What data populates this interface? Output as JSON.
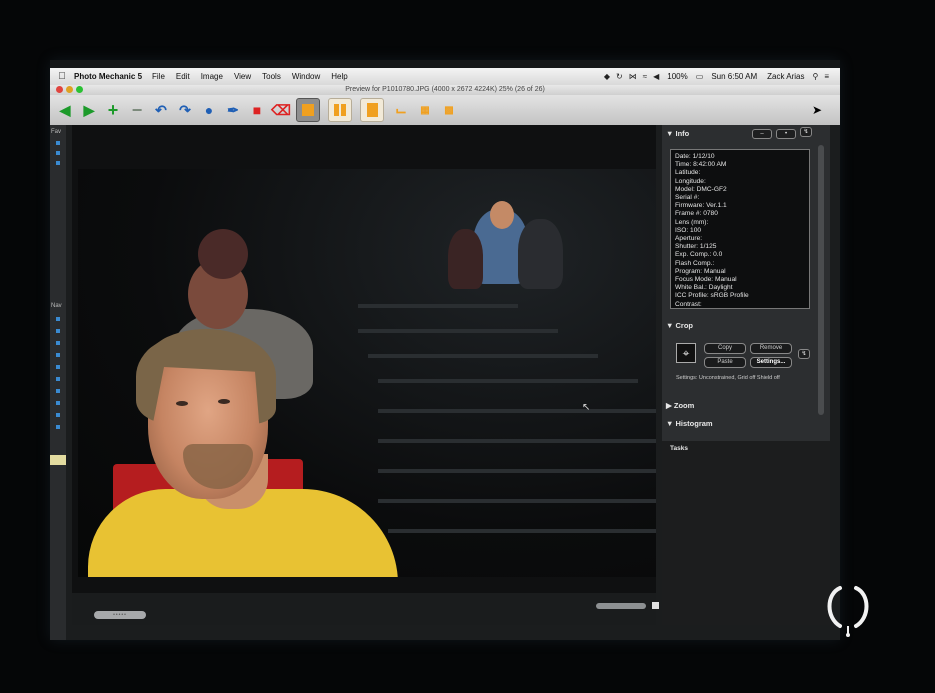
{
  "menubar": {
    "app_name": "Photo Mechanic 5",
    "items": [
      "File",
      "Edit",
      "Image",
      "View",
      "Tools",
      "Window",
      "Help"
    ],
    "battery": "100%",
    "clock": "Sun 6:50 AM",
    "user": "Zack Arias"
  },
  "window": {
    "title": "Preview for P1010780.JPG (4000 x 2672 4224K) 25% (26 of 26)"
  },
  "sidebar": {
    "label_top": "Fav",
    "label_nav": "Nav"
  },
  "info_panel": {
    "header": "Info",
    "lines": [
      "Date: 1/12/10",
      "Time: 8:42:00 AM",
      "Latitude:",
      "Longitude:",
      "Model: DMC-GF2",
      "Serial #:",
      "Firmware: Ver.1.1",
      "Frame #: 0780",
      "Lens (mm):",
      "ISO: 100",
      "Aperture:",
      "Shutter: 1/125",
      "Exp. Comp.: 0.0",
      "Flash Comp.:",
      "Program: Manual",
      "Focus Mode: Manual",
      "White Bal.: Daylight",
      "ICC Profile: sRGB Profile",
      "Contrast:"
    ]
  },
  "crop_panel": {
    "header": "Crop",
    "copy_label": "Copy",
    "remove_label": "Remove",
    "paste_label": "Paste",
    "settings_label": "Settings...",
    "settings_line": "Settings:   Unconstrained, Grid off Shield off"
  },
  "zoom_panel": {
    "header": "Zoom"
  },
  "histogram_panel": {
    "header": "Histogram"
  },
  "tasks_panel": {
    "header": "Tasks"
  },
  "colors": {
    "accent_orange": "#f0a020",
    "shirt_yellow": "#e8c233",
    "seat_red": "#b51d1f"
  }
}
